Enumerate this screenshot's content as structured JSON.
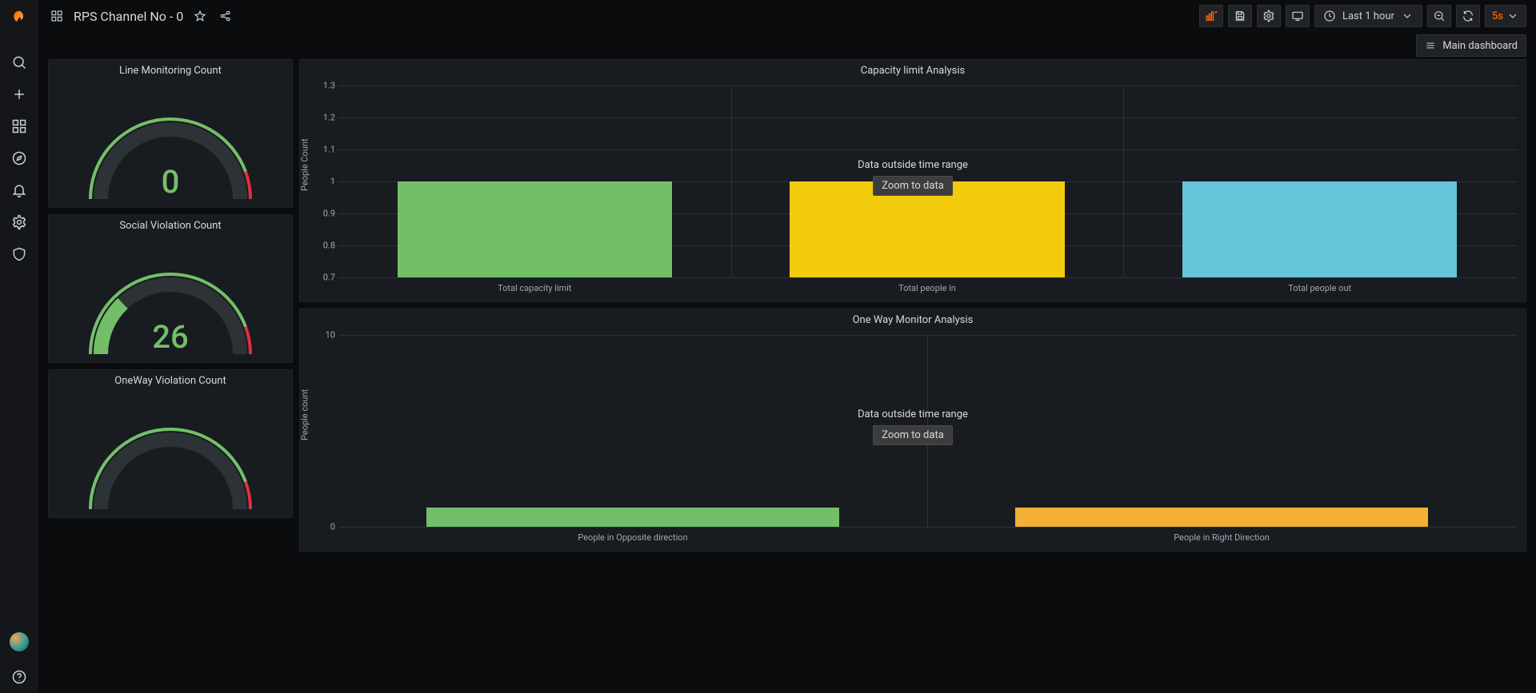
{
  "header": {
    "title": "RPS Channel No - 0",
    "time_range_label": "Last 1 hour",
    "refresh_rate": "5s"
  },
  "submenu": {
    "main_dashboard_link": "Main dashboard"
  },
  "gauges": [
    {
      "title": "Line Monitoring Count",
      "value": "0",
      "fill_fraction": 0.0
    },
    {
      "title": "Social Violation Count",
      "value": "26",
      "fill_fraction": 0.26
    },
    {
      "title": "OneWay Violation Count",
      "value": "",
      "fill_fraction": 0.0
    }
  ],
  "overlay": {
    "message": "Data outside time range",
    "button": "Zoom to data"
  },
  "chart_data": [
    {
      "type": "bar",
      "title": "Capacity limit Analysis",
      "ylabel": "People Count",
      "ylim": [
        0.7,
        1.3
      ],
      "yticks": [
        0.7,
        0.8,
        0.9,
        1.0,
        1.1,
        1.2,
        1.3
      ],
      "categories": [
        "Total capacity limit",
        "Total people in",
        "Total people out"
      ],
      "values": [
        1.0,
        1.0,
        1.0
      ],
      "colors": [
        "#73bf69",
        "#f2cc0c",
        "#65c5db"
      ]
    },
    {
      "type": "bar",
      "title": "One Way Monitor Analysis",
      "ylabel": "People count",
      "ylim": [
        0,
        10
      ],
      "yticks": [
        0,
        10
      ],
      "categories": [
        "People in Opposite direction",
        "People in Right Direction"
      ],
      "values": [
        1,
        1
      ],
      "colors": [
        "#73bf69",
        "#f2b134"
      ]
    }
  ]
}
